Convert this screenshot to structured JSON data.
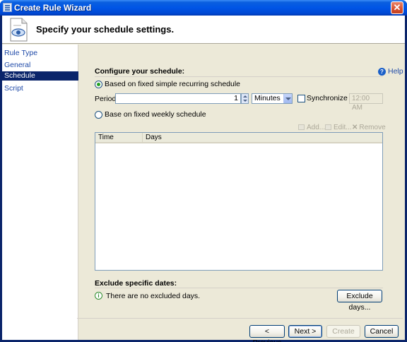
{
  "window": {
    "title": "Create Rule Wizard",
    "close_glyph": "✕"
  },
  "header": {
    "title": "Specify your schedule settings."
  },
  "sidebar": {
    "items": [
      {
        "label": "Rule Type",
        "active": false
      },
      {
        "label": "General",
        "active": false
      },
      {
        "label": "Schedule",
        "active": true
      },
      {
        "label": "Script",
        "active": false
      }
    ]
  },
  "help": {
    "label": "Help",
    "glyph": "?"
  },
  "schedule": {
    "section_title": "Configure your schedule:",
    "simple_option": "Based on fixed simple recurring schedule",
    "period_label": "Period:",
    "period_value": "1",
    "unit_value": "Minutes",
    "sync_label": "Synchronize at:",
    "sync_time": "12:00 AM",
    "weekly_option": "Base on fixed weekly schedule",
    "toolbar": {
      "add": "Add...",
      "edit": "Edit...",
      "remove": "Remove"
    },
    "columns": [
      "Time",
      "Days"
    ]
  },
  "exclude": {
    "section_title": "Exclude specific dates:",
    "status": "There are no excluded days.",
    "button": "Exclude days..."
  },
  "footer": {
    "previous": "< Previous",
    "next": "Next >",
    "create": "Create",
    "cancel": "Cancel"
  },
  "colors": {
    "titlebar": "#0055e5",
    "nav_active": "#0a246a",
    "link": "#1f4aa8",
    "radio_dot": "#21a121"
  }
}
